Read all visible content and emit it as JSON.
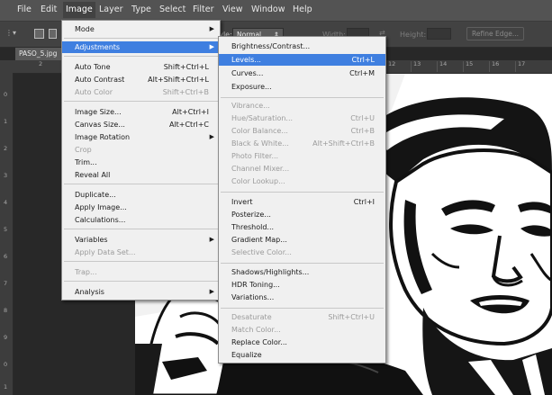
{
  "menubar": {
    "items": [
      "File",
      "Edit",
      "Image",
      "Layer",
      "Type",
      "Select",
      "Filter",
      "View",
      "Window",
      "Help"
    ],
    "active": "Image"
  },
  "options_bar": {
    "style_label": "Style:",
    "style_value": "Normal",
    "width_label": "Width:",
    "height_label": "Height:",
    "refine_edge": "Refine Edge..."
  },
  "document": {
    "tab_title": "PASO_5.jpg"
  },
  "ruler": {
    "top_ticks": [
      "2",
      "12",
      "13",
      "14",
      "15",
      "16",
      "17"
    ],
    "left_ticks": [
      "0",
      "1",
      "2",
      "3",
      "4",
      "5",
      "6",
      "7",
      "8",
      "9",
      "0",
      "1"
    ]
  },
  "image_menu": {
    "items": [
      {
        "label": "Mode",
        "shortcut": "",
        "submenu": true,
        "disabled": false
      },
      {
        "label": "Adjustments",
        "shortcut": "",
        "submenu": true,
        "disabled": false,
        "highlighted": true
      },
      {
        "label": "Auto Tone",
        "shortcut": "Shift+Ctrl+L",
        "disabled": false
      },
      {
        "label": "Auto Contrast",
        "shortcut": "Alt+Shift+Ctrl+L",
        "disabled": false
      },
      {
        "label": "Auto Color",
        "shortcut": "Shift+Ctrl+B",
        "disabled": true
      },
      {
        "label": "Image Size...",
        "shortcut": "Alt+Ctrl+I",
        "disabled": false
      },
      {
        "label": "Canvas Size...",
        "shortcut": "Alt+Ctrl+C",
        "disabled": false
      },
      {
        "label": "Image Rotation",
        "shortcut": "",
        "submenu": true,
        "disabled": false
      },
      {
        "label": "Crop",
        "shortcut": "",
        "disabled": true
      },
      {
        "label": "Trim...",
        "shortcut": "",
        "disabled": false
      },
      {
        "label": "Reveal All",
        "shortcut": "",
        "disabled": false
      },
      {
        "label": "Duplicate...",
        "shortcut": "",
        "disabled": false
      },
      {
        "label": "Apply Image...",
        "shortcut": "",
        "disabled": false
      },
      {
        "label": "Calculations...",
        "shortcut": "",
        "disabled": false
      },
      {
        "label": "Variables",
        "shortcut": "",
        "submenu": true,
        "disabled": false
      },
      {
        "label": "Apply Data Set...",
        "shortcut": "",
        "disabled": true
      },
      {
        "label": "Trap...",
        "shortcut": "",
        "disabled": true
      },
      {
        "label": "Analysis",
        "shortcut": "",
        "submenu": true,
        "disabled": false
      }
    ]
  },
  "adjustments_menu": {
    "items": [
      {
        "label": "Brightness/Contrast...",
        "shortcut": "",
        "disabled": false
      },
      {
        "label": "Levels...",
        "shortcut": "Ctrl+L",
        "disabled": false,
        "highlighted": true
      },
      {
        "label": "Curves...",
        "shortcut": "Ctrl+M",
        "disabled": false
      },
      {
        "label": "Exposure...",
        "shortcut": "",
        "disabled": false
      },
      {
        "label": "Vibrance...",
        "shortcut": "",
        "disabled": true
      },
      {
        "label": "Hue/Saturation...",
        "shortcut": "Ctrl+U",
        "disabled": true
      },
      {
        "label": "Color Balance...",
        "shortcut": "Ctrl+B",
        "disabled": true
      },
      {
        "label": "Black & White...",
        "shortcut": "Alt+Shift+Ctrl+B",
        "disabled": true
      },
      {
        "label": "Photo Filter...",
        "shortcut": "",
        "disabled": true
      },
      {
        "label": "Channel Mixer...",
        "shortcut": "",
        "disabled": true
      },
      {
        "label": "Color Lookup...",
        "shortcut": "",
        "disabled": true
      },
      {
        "label": "Invert",
        "shortcut": "Ctrl+I",
        "disabled": false
      },
      {
        "label": "Posterize...",
        "shortcut": "",
        "disabled": false
      },
      {
        "label": "Threshold...",
        "shortcut": "",
        "disabled": false
      },
      {
        "label": "Gradient Map...",
        "shortcut": "",
        "disabled": false
      },
      {
        "label": "Selective Color...",
        "shortcut": "",
        "disabled": true
      },
      {
        "label": "Shadows/Highlights...",
        "shortcut": "",
        "disabled": false
      },
      {
        "label": "HDR Toning...",
        "shortcut": "",
        "disabled": false
      },
      {
        "label": "Variations...",
        "shortcut": "",
        "disabled": false
      },
      {
        "label": "Desaturate",
        "shortcut": "Shift+Ctrl+U",
        "disabled": true
      },
      {
        "label": "Match Color...",
        "shortcut": "",
        "disabled": true
      },
      {
        "label": "Replace Color...",
        "shortcut": "",
        "disabled": false
      },
      {
        "label": "Equalize",
        "shortcut": "",
        "disabled": false
      }
    ]
  },
  "colors": {
    "highlight": "#3f7fe0",
    "menu_bg": "#f0f0f0",
    "chrome": "#535353"
  }
}
